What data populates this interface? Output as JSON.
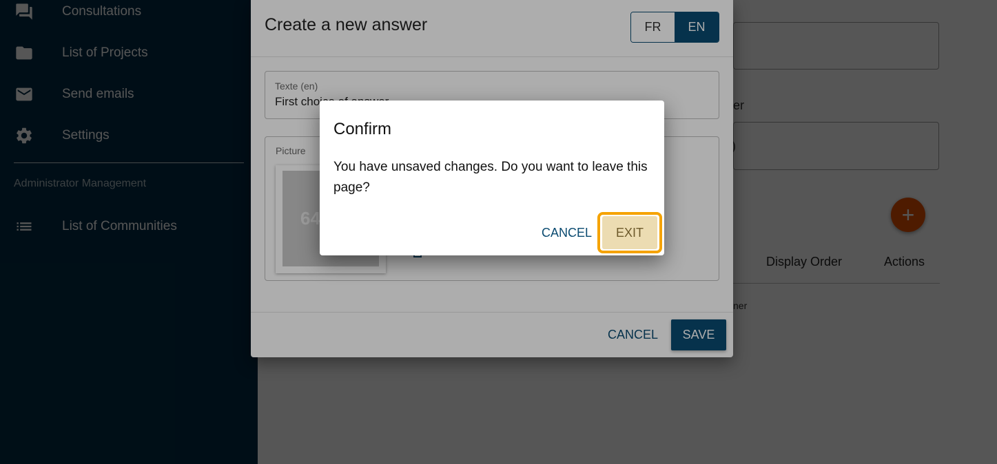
{
  "sidebar": {
    "items": [
      {
        "label": "Consultations",
        "icon": "forum-icon"
      },
      {
        "label": "List of Projects",
        "icon": "folder-icon"
      },
      {
        "label": "Send emails",
        "icon": "mail-icon"
      },
      {
        "label": "Settings",
        "icon": "gear-icon"
      }
    ],
    "section_title": "Administrator Management",
    "admin_items": [
      {
        "label": "List of Communities",
        "icon": "list-icon"
      }
    ]
  },
  "background": {
    "field_label_fragment": "er",
    "field_value_fragment": ")",
    "add_button": "+",
    "columns": [
      "Display Order",
      "Actions"
    ],
    "row_fragment": "ner"
  },
  "answer_dialog": {
    "title": "Create a new answer",
    "languages": [
      "FR",
      "EN"
    ],
    "active_language": "EN",
    "text_field": {
      "label": "Texte (en)",
      "value": "First choice of answer"
    },
    "picture_field": {
      "label": "Picture",
      "placeholder_text": "64"
    },
    "cancel_label": "CANCEL",
    "save_label": "SAVE"
  },
  "confirm_dialog": {
    "title": "Confirm",
    "message": "You have unsaved changes. Do you want to leave this page?",
    "cancel_label": "CANCEL",
    "exit_label": "EXIT"
  },
  "colors": {
    "sidebar_bg": "#002b44",
    "primary": "#0a4a70",
    "fab": "#e65100",
    "focus_ring": "#f5a300"
  }
}
